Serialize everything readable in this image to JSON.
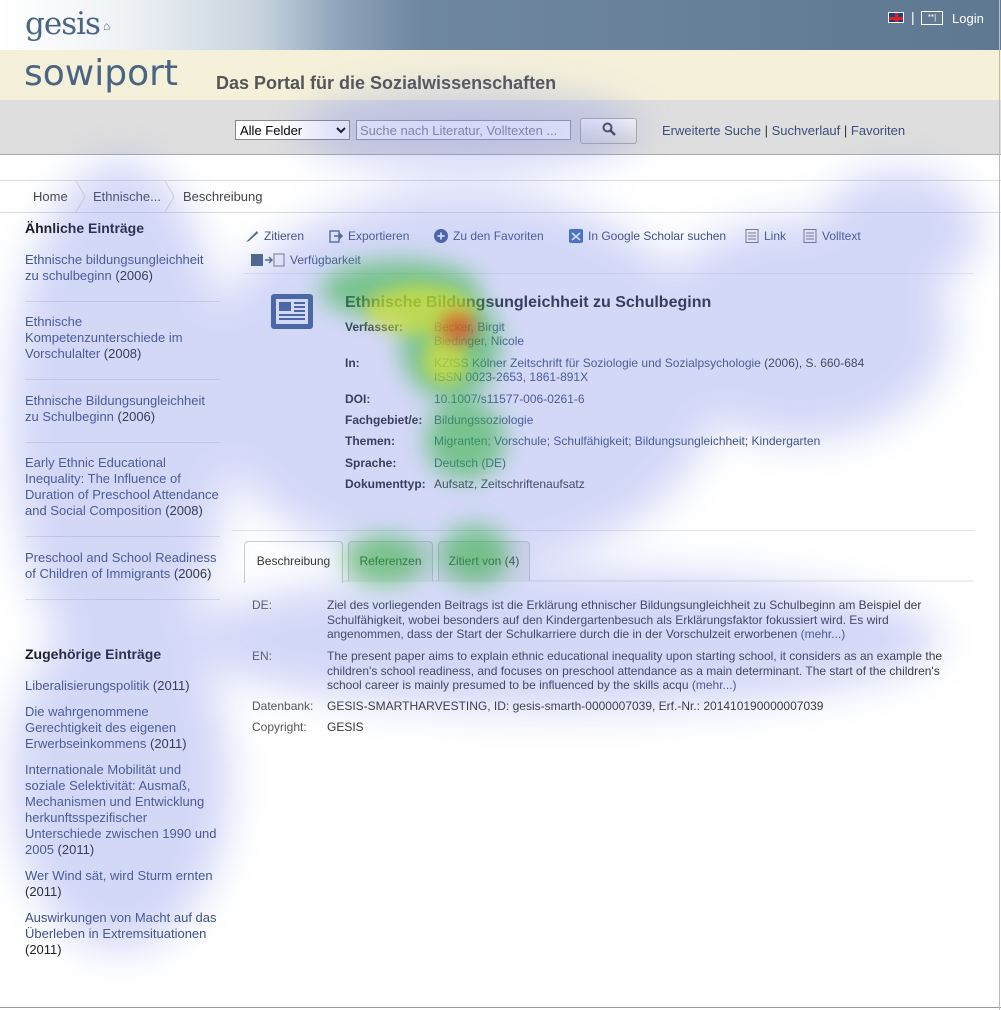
{
  "header": {
    "logo": "gesis",
    "login_icon": "**|",
    "login": "Login",
    "flag_icon": "uk-flag-icon",
    "separator": "|"
  },
  "brand": {
    "logo": "sowiport",
    "tagline": "Das Portal für die Sozialwissenschaften"
  },
  "search": {
    "field_selected": "Alle Felder",
    "placeholder": "Suche nach Literatur, Volltexten ...",
    "button_icon": "search-icon",
    "links": [
      "Erweiterte Suche",
      "Suchverlauf",
      "Favoriten"
    ]
  },
  "breadcrumb": [
    "Home",
    "Ethnische...",
    "Beschreibung"
  ],
  "sidebar": {
    "similar_heading": "Ähnliche Einträge",
    "similar": [
      {
        "title": "Ethnische bildungsungleichheit zu schulbeginn",
        "year": "(2006)"
      },
      {
        "title": "Ethnische Kompetenzunterschiede im Vorschulalter",
        "year": "(2008)"
      },
      {
        "title": "Ethnische Bildungsungleichheit zu Schulbeginn",
        "year": "(2006)"
      },
      {
        "title": "Early Ethnic Educational Inequality: The Influence of Duration of Preschool Attendance and Social Composition",
        "year": "(2008)"
      },
      {
        "title": "Preschool and School Readiness of Children of Immigrants",
        "year": "(2006)"
      }
    ],
    "related_heading": "Zugehörige Einträge",
    "related": [
      {
        "title": "Liberalisierungspolitik",
        "year": "(2011)"
      },
      {
        "title": "Die wahrgenommene Gerechtigkeit des eigenen Erwerbseinkommens",
        "year": "(2011)"
      },
      {
        "title": "Internationale Mobilität und soziale Selektivität: Ausmaß, Mechanismen und Entwicklung herkunftsspezifischer Unterschiede zwischen 1990 und 2005",
        "year": "(2011)"
      },
      {
        "title": "Wer Wind sät, wird Sturm ernten",
        "year": "(2011)"
      },
      {
        "title": "Auswirkungen von Macht auf das Überleben in Extremsituationen",
        "year": "(2011)"
      }
    ]
  },
  "actions": {
    "cite": "Zitieren",
    "export": "Exportieren",
    "favorites": "Zu den Favoriten",
    "scholar": "In Google Scholar suchen",
    "link": "Link",
    "fulltext": "Volltext",
    "availability": "Verfügbarkeit"
  },
  "record": {
    "title": "Ethnische Bildungsungleichheit zu Schulbeginn",
    "labels": {
      "authors": "Verfasser:",
      "in": "In:",
      "doi": "DOI:",
      "field": "Fachgebiet/e:",
      "topics": "Themen:",
      "language": "Sprache:",
      "doctype": "Dokumenttyp:"
    },
    "authors": [
      "Becker, Birgit",
      "Biedinger, Nicole"
    ],
    "in_journal": "KZfSS Kölner Zeitschrift für Soziologie und Sozialpsychologie",
    "in_details": " (2006), S. 660-684",
    "issn": "ISSN 0023-2653, 1861-891X",
    "doi": "10.1007/s11577-006-0261-6",
    "field": "Bildungssoziologie",
    "topics": "Migranten; Vorschule; Schulfähigkeit; Bildungsungleichheit; Kindergarten",
    "language": "Deutsch (DE)",
    "doctype": "Aufsatz, Zeitschriftenaufsatz"
  },
  "tabs": [
    "Beschreibung",
    "Referenzen",
    "Zitiert von (4)"
  ],
  "description": {
    "de_label": "DE:",
    "de_text": "Ziel des vorliegenden Beitrags ist die Erklärung ethnischer Bildungsungleichheit zu Schulbeginn am Beispiel der Schulfähigkeit, wobei besonders auf den Kindergartenbesuch als Erklärungsfaktor fokussiert wird. Es wird angenommen, dass der Start der Schulkarriere durch die in der Vorschulzeit erworbenen",
    "en_label": "EN:",
    "en_text": "The present paper aims to explain ethnic educational inequality upon starting school, it considers as an example the children's school readiness, and focuses on preschool attendance as a main determinant. The start of the children's school career is mainly presumed to be influenced by the skills acqu",
    "more": "(mehr...)",
    "db_label": "Datenbank:",
    "db_value": "GESIS-SMARTHARVESTING, ID: gesis-smarth-0000007039, Erf.-Nr.: 201410190000007039",
    "copyright_label": "Copyright:",
    "copyright_value": "GESIS"
  },
  "colors": {
    "link": "#3b4f7a",
    "brand_band": "#f4f0d9",
    "topbar_dark": "#5e7892"
  }
}
